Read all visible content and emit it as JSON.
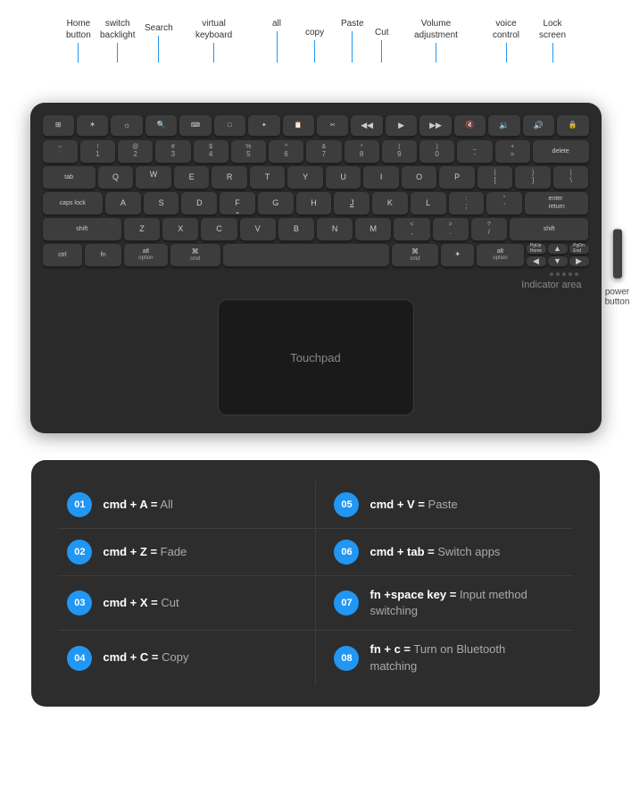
{
  "labels": {
    "home_button": "Home\nbutton",
    "switch_backlight": "switch\nbacklight",
    "search": "Search",
    "virtual_keyboard": "virtual\nkeyboard",
    "all": "all",
    "copy": "copy",
    "paste": "Paste",
    "cut": "Cut",
    "volume_adjustment": "Volume\nadjustment",
    "voice_control": "voice\ncontrol",
    "lock_screen": "Lock\nscreen",
    "indicator_area": "Indicator area",
    "touchpad": "Touchpad",
    "power_button": "power\nbutton"
  },
  "shortcuts": [
    {
      "id": "01",
      "combo": "cmd + A =",
      "result": " All"
    },
    {
      "id": "05",
      "combo": "cmd + V =",
      "result": "  Paste"
    },
    {
      "id": "02",
      "combo": "cmd + Z =",
      "result": " Fade"
    },
    {
      "id": "06",
      "combo": "cmd + tab =",
      "result": "Switch apps"
    },
    {
      "id": "03",
      "combo": "cmd + X =",
      "result": "  Cut"
    },
    {
      "id": "07",
      "combo": "fn +space key =",
      "result": " Input method\nswitching"
    },
    {
      "id": "04",
      "combo": "cmd + C =",
      "result": "  Copy"
    },
    {
      "id": "08",
      "combo": "fn + c =",
      "result": "  Turn on Bluetooth\nmatching"
    }
  ]
}
